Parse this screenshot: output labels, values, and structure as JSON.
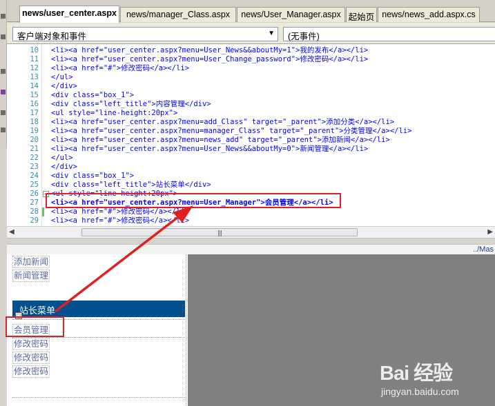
{
  "tabs": [
    {
      "label": "news/user_center.aspx",
      "active": true
    },
    {
      "label": "news/manager_Class.aspx",
      "active": false
    },
    {
      "label": "news/User_Manager.aspx",
      "active": false
    },
    {
      "label": "起始页",
      "active": false
    },
    {
      "label": "news/news_add.aspx.cs",
      "active": false
    }
  ],
  "dropdowns": {
    "object_select": "客户端对象和事件",
    "event_select": "(无事件)"
  },
  "code_lines": [
    {
      "num": "10",
      "text": "<li><a href=\"user_center.aspx?menu=User_News&&aboutMy=1\">我的发布</a></li>"
    },
    {
      "num": "11",
      "text": "<li><a href=\"user_center.aspx?menu=User_Change_password\">修改密码</a></li>"
    },
    {
      "num": "12",
      "text": "<li><a href=\"#\">修改密码</a></li>"
    },
    {
      "num": "13",
      "text": "</ul>"
    },
    {
      "num": "14",
      "text": "</div>"
    },
    {
      "num": "15",
      "text": "<div class=\"box_1\">"
    },
    {
      "num": "16",
      "text": "<div class=\"left_title\">内容管理</div>"
    },
    {
      "num": "17",
      "text": "<ul style=\"line-height:20px\">"
    },
    {
      "num": "18",
      "text": "<li><a href=\"user_center.aspx?menu=add_Class\" target=\"_parent\">添加分类</a></li>"
    },
    {
      "num": "19",
      "text": "<li><a href=\"user_center.aspx?menu=manager_Class\" target=\"_parent\">分类管理</a></li>"
    },
    {
      "num": "20",
      "text": "<li><a href=\"user_center.aspx?menu=news_add\" target=\"_parent\">添加新闻</a></li>"
    },
    {
      "num": "21",
      "text": "<li><a href=\"user_center.aspx?menu=User_News&&aboutMy=0\">新闻管理</a></li>"
    },
    {
      "num": "22",
      "text": "</ul>"
    },
    {
      "num": "23",
      "text": "</div>"
    },
    {
      "num": "24",
      "text": "<div class=\"box_1\">"
    },
    {
      "num": "25",
      "text": "<div class=\"left_title\">站长菜单</div>"
    },
    {
      "num": "26",
      "text": "<ul style=\"line-height:20px\">"
    },
    {
      "num": "27",
      "text": "<li><a href=\"user_center.aspx?menu=User_Manager\">会员管理</a></li>"
    },
    {
      "num": "28",
      "text": "<li><a href=\"#\">修改密码</a></li>"
    },
    {
      "num": "29",
      "text": "<li><a href=\"#\">修改密码</a></li>"
    }
  ],
  "path_bar": "../Mas",
  "design_links": {
    "add_news": "添加新闻",
    "news_manage": "新闻管理",
    "admin_menu_title": "站长菜单",
    "member_manage": "会员管理",
    "change_pwd_1": "修改密码",
    "change_pwd_2": "修改密码",
    "change_pwd_3": "修改密码"
  },
  "watermark": {
    "main": "Bai 经验",
    "sub": "jingyan.baidu.com"
  },
  "colors": {
    "code_blue": "#0000ff",
    "line_number": "#2b91af",
    "banner_blue": "#02508e",
    "annotation_red": "#e02020"
  }
}
